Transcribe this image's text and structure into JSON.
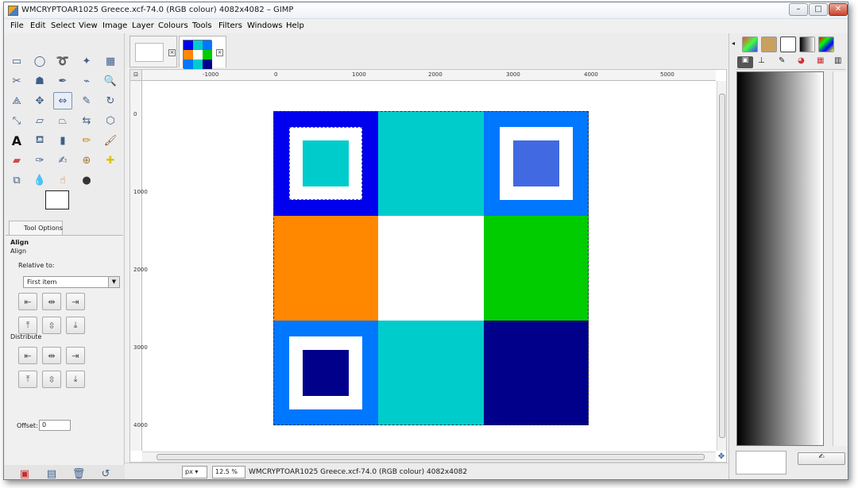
{
  "window": {
    "title": "WMCRYPTOAR1025 Greece.xcf-74.0 (RGB colour) 4082x4082 – GIMP",
    "controls": {
      "minimize": "–",
      "maximize": "□",
      "close": "✕"
    }
  },
  "menu": [
    "File",
    "Edit",
    "Select",
    "View",
    "Image",
    "Layer",
    "Colours",
    "Tools",
    "Filters",
    "Windows",
    "Help"
  ],
  "tool_options": {
    "tab_label": "Tool Options",
    "tool_name": "Align",
    "tool_subtitle": "Align",
    "relative_to_label": "Relative to:",
    "relative_to_value": "First item",
    "distribute_label": "Distribute",
    "offset_label": "Offset:",
    "offset_value": "0"
  },
  "ruler": {
    "h_labels": [
      "-1000",
      "0",
      "1000",
      "2000",
      "3000",
      "4000",
      "5000"
    ],
    "v_labels": [
      "0",
      "1000",
      "2000",
      "3000",
      "4000"
    ]
  },
  "image_tabs": [
    "blank",
    "greece"
  ],
  "status": {
    "unit": "px",
    "zoom": "12.5 %",
    "info": "WMCRYPTOAR1025 Greece.xcf-74.0 (RGB colour) 4082x4082"
  },
  "palette": {
    "blue": "#0000ee",
    "cyan": "#00cccc",
    "azure": "#0077ff",
    "royal": "#4169e1",
    "orange": "#ff8800",
    "white": "#ffffff",
    "green": "#00cc00",
    "navy": "#00008b"
  },
  "icons": [
    "rect-select-icon",
    "ellipse-select-icon",
    "lasso-icon",
    "fuzzy-select-icon",
    "color-select-icon",
    "scissors-icon",
    "foreground-select-icon",
    "paths-icon",
    "color-picker-icon",
    "zoom-icon",
    "measure-icon",
    "move-icon",
    "align-icon",
    "crop-icon",
    "rotate-icon",
    "scale-icon",
    "shear-icon",
    "perspective-icon",
    "flip-icon",
    "cage-icon",
    "text-icon",
    "bucket-fill-icon",
    "blend-icon",
    "pencil-icon",
    "paintbrush-icon",
    "eraser-icon",
    "airbrush-icon",
    "ink-icon",
    "clone-icon",
    "heal-icon",
    "perspective-clone-icon",
    "blur-icon",
    "smudge-icon",
    "dodge-burn-icon"
  ]
}
